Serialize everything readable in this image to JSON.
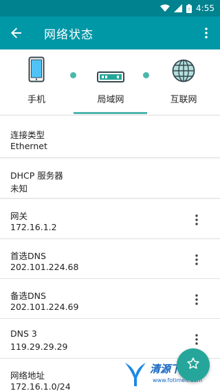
{
  "status_bar": {
    "time": "4:55",
    "icons": [
      "wifi-icon",
      "signal-icon",
      "battery-icon"
    ]
  },
  "app_bar": {
    "title": "网络状态",
    "back_icon": "arrow-back-icon",
    "menu_icon": "more-vert-icon",
    "background": "#0097a7"
  },
  "tabs": [
    {
      "label": "手机",
      "icon": "phone-icon"
    },
    {
      "label": "局域网",
      "icon": "router-icon",
      "selected": true
    },
    {
      "label": "互联网",
      "icon": "globe-icon"
    }
  ],
  "accent": "#4db6ac",
  "rows": [
    {
      "key": "连接类型",
      "value": "Ethernet",
      "has_menu": false
    },
    {
      "key": "DHCP 服务器",
      "value": "未知",
      "has_menu": false
    },
    {
      "key": "网关",
      "value": "172.16.1.2",
      "has_menu": true
    },
    {
      "key": "首选DNS",
      "value": "202.101.224.68",
      "has_menu": true
    },
    {
      "key": "备选DNS",
      "value": "202.101.224.69",
      "has_menu": true
    },
    {
      "key": "DNS 3",
      "value": "119.29.29.29",
      "has_menu": true
    },
    {
      "key": "网络地址",
      "value": "172.16.1.0/24",
      "has_menu": false
    }
  ],
  "fab": {
    "icon": "star-icon",
    "color": "#26a69a"
  },
  "watermark": {
    "text": "清源下载站",
    "url": "www.fotimeit.com"
  }
}
